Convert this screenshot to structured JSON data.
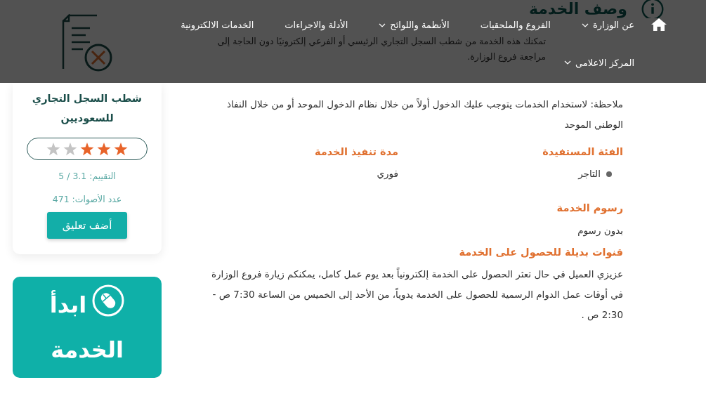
{
  "navbar": {
    "items": [
      {
        "label": "عن الوزارة",
        "dropdown": true
      },
      {
        "label": "الفروع والملحقيات",
        "dropdown": false
      },
      {
        "label": "الأنظمة واللوائح",
        "dropdown": true
      },
      {
        "label": "الأدلة والاجراءات",
        "dropdown": false
      },
      {
        "label": "الخدمات الالكترونية",
        "dropdown": false
      },
      {
        "label": "المركز الاعلامي",
        "dropdown": true
      }
    ]
  },
  "service_header": {
    "title": "وصف الخدمة",
    "description": "تمكنك هذه الخدمة من شطب السجل التجاري الرئيسي أو الفرعي إلكترونيًا دون الحاجة إلى مراجعة فروع الوزارة."
  },
  "sidebar": {
    "service_name": "شطب السجل التجاري للسعوديين",
    "stars": 3,
    "rating": "التقييم: 3.1 / 5",
    "votes": "عدد الأصوات: 471",
    "comment_button": "أضف تعليق",
    "start_button": "ابدأ الخدمة"
  },
  "content": {
    "note": "ملاحظة: لاستخدام الخدمات يتوجب عليك الدخول أولاً من خلال نظام الدخول الموحد أو من خلال النفاذ الوطني الموحد",
    "beneficiary": {
      "heading": "الفئة المستفيدة",
      "items": [
        "التاجر"
      ]
    },
    "duration": {
      "heading": "مدة تنفيذ الخدمة",
      "value": "فوري"
    },
    "fees": {
      "heading": "رسوم الخدمة",
      "value": "بدون رسوم"
    },
    "alternative_channels": {
      "heading": "قنوات بديلة للحصول على الخدمة",
      "text": "عزيزي العميل في حال تعثر الحصول على الخدمة إلكترونياً بعد يوم عمل كامل، يمكنكم زيارة فروع الوزارة في أوقات عمل الدوام الرسمية للحصول على الخدمة يدوياً، من الأحد إلى الخميس من الساعة 7:30 ص - 2:30 ص ."
    }
  }
}
